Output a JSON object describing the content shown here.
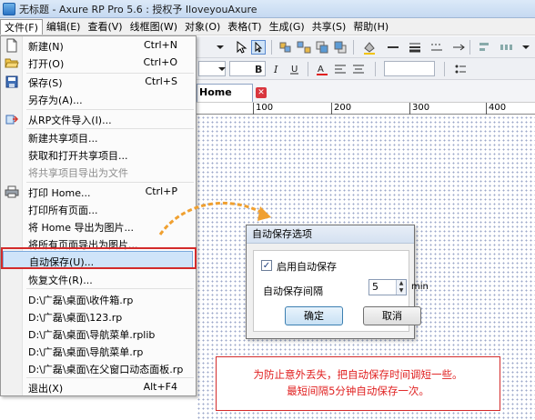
{
  "title_bar": {
    "title": "无标题 - Axure RP Pro 5.6 : 授权予 IloveyouAxure"
  },
  "menubar": [
    {
      "label": "文件(F)"
    },
    {
      "label": "编辑(E)"
    },
    {
      "label": "查看(V)"
    },
    {
      "label": "线框图(W)"
    },
    {
      "label": "对象(O)"
    },
    {
      "label": "表格(T)"
    },
    {
      "label": "生成(G)"
    },
    {
      "label": "共享(S)"
    },
    {
      "label": "帮助(H)"
    }
  ],
  "file_menu": {
    "items": [
      {
        "label": "新建(N)",
        "shortcut": "Ctrl+N",
        "icon": "new-file-icon"
      },
      {
        "label": "打开(O)",
        "shortcut": "Ctrl+O",
        "icon": "open-folder-icon"
      },
      {
        "label": "保存(S)",
        "shortcut": "Ctrl+S",
        "icon": "save-icon"
      },
      {
        "label": "另存为(A)...",
        "shortcut": ""
      },
      {
        "label": "从RP文件导入(I)...",
        "shortcut": "",
        "icon": "import-icon"
      },
      {
        "label": "新建共享项目...",
        "shortcut": ""
      },
      {
        "label": "获取和打开共享项目...",
        "shortcut": ""
      },
      {
        "label": "将共享项目导出为文件",
        "shortcut": "",
        "disabled": true
      },
      {
        "label": "打印 Home...",
        "shortcut": "Ctrl+P",
        "icon": "print-icon"
      },
      {
        "label": "打印所有页面...",
        "shortcut": ""
      },
      {
        "label": "将 Home 导出为图片...",
        "shortcut": ""
      },
      {
        "label": "将所有页面导出为图片...",
        "shortcut": ""
      },
      {
        "label": "自动保存(U)...",
        "shortcut": "",
        "highlighted": true
      },
      {
        "label": "恢复文件(R)...",
        "shortcut": ""
      },
      {
        "label": "D:\\广磊\\桌面\\收件箱.rp",
        "shortcut": ""
      },
      {
        "label": "D:\\广磊\\桌面\\123.rp",
        "shortcut": ""
      },
      {
        "label": "D:\\广磊\\桌面\\导航菜单.rplib",
        "shortcut": ""
      },
      {
        "label": "D:\\广磊\\桌面\\导航菜单.rp",
        "shortcut": ""
      },
      {
        "label": "D:\\广磊\\桌面\\在父窗口动态面板.rp",
        "shortcut": ""
      },
      {
        "label": "退出(X)",
        "shortcut": "Alt+F4"
      }
    ]
  },
  "tab": {
    "label": "Home"
  },
  "ruler": {
    "ticks": [
      "100",
      "200",
      "300",
      "400"
    ]
  },
  "dialog": {
    "title": "自动保存选项",
    "enable_label": "启用自动保存",
    "enable_checked": true,
    "interval_label": "自动保存间隔",
    "interval_value": "5",
    "unit": "min",
    "ok_label": "确定",
    "cancel_label": "取消"
  },
  "note": {
    "line1": "为防止意外丢失，把自动保存时间调短一些。",
    "line2": "最短间隔5分钟自动保存一次。"
  },
  "colors": {
    "highlight_box": "#d32b2b",
    "note_text": "#e02020",
    "arrow": "#f0a030"
  }
}
